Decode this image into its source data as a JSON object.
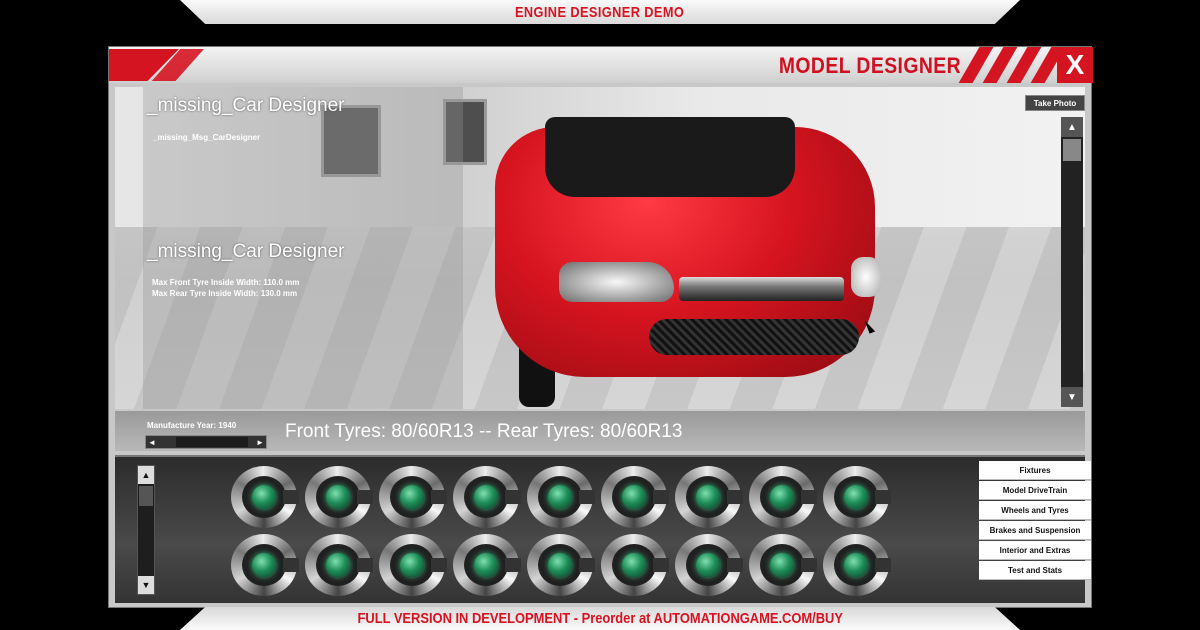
{
  "top_banner": "ENGINE DESIGNER DEMO",
  "bottom_banner": "FULL VERSION IN DEVELOPMENT - Preorder at AUTOMATIONGAME.COM/BUY",
  "window": {
    "title": "MODEL DESIGNER",
    "close_label": "X"
  },
  "viewport": {
    "title_top": "_missing_Car Designer",
    "msg": "_missing_Msg_CarDesigner",
    "title_bottom": "_missing_Car Designer",
    "spec_front": "Max Front Tyre Inside Width: 110.0 mm",
    "spec_rear": "Max Rear Tyre Inside Width: 130.0 mm",
    "take_photo": "Take Photo",
    "scroll_up": "▲",
    "scroll_down": "▼"
  },
  "status": {
    "manufacture_year": "Manufacture Year: 1940",
    "slider_left": "◄",
    "slider_right": "►",
    "tyres": "Front Tyres: 80/60R13 -- Rear Tyres: 80/60R13"
  },
  "parts_panel": {
    "scroll_up": "▲",
    "scroll_down": "▼",
    "button_count": 18
  },
  "menu": {
    "items": [
      {
        "label": "Fixtures"
      },
      {
        "label": "Model DriveTrain"
      },
      {
        "label": "Wheels and Tyres"
      },
      {
        "label": "Brakes and Suspension"
      },
      {
        "label": "Interior and Extras"
      },
      {
        "label": "Test and Stats"
      }
    ]
  }
}
